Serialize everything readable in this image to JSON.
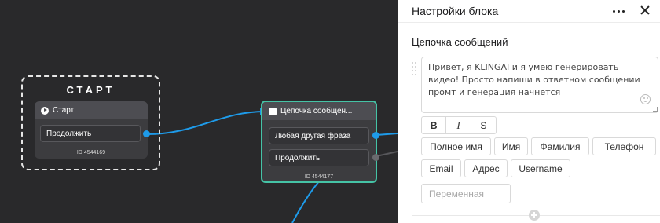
{
  "canvas": {
    "start_title": "СТАРТ",
    "start_node": {
      "header": "Старт",
      "button": "Продолжить",
      "id_text": "ID 4544169"
    },
    "message_node": {
      "header": "Цепочка сообщен...",
      "rows": [
        "Любая другая фраза",
        "Продолжить"
      ],
      "id_text": "ID 4544177"
    },
    "colors": {
      "wire": "#1e9bea",
      "active_border": "#45c3a6"
    }
  },
  "panel": {
    "title": "Настройки блока",
    "section_title": "Цепочка сообщений",
    "message_text": "Привет, я KLINGAI и я умею генерировать видео! Просто напиши в ответном сообщении промт и генерация начнется",
    "format_buttons": {
      "bold": "B",
      "italic": "I",
      "strike": "S"
    },
    "variable_chips": [
      "Полное имя",
      "Имя",
      "Фамилия",
      "Телефон",
      "Email",
      "Адрес",
      "Username"
    ],
    "variable_placeholder": "Переменная"
  }
}
